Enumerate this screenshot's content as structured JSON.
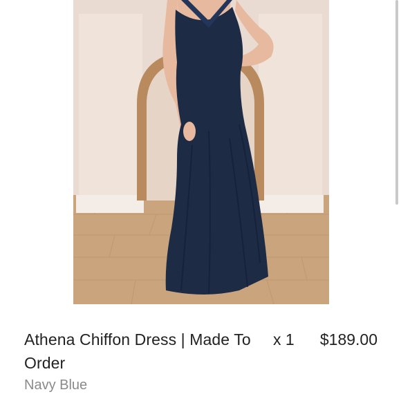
{
  "order_item": {
    "name": "Athena Chiffon Dress | Made To Order",
    "variant": "Navy Blue",
    "quantity": "x 1",
    "price": "$189.00",
    "image_alt": "Model wearing navy halter chiffon maxi dress"
  },
  "colors": {
    "dress": "#1d2b45",
    "wall": "#eadbd2",
    "floor": "#c8a27a",
    "arch": "#b98a5e"
  }
}
